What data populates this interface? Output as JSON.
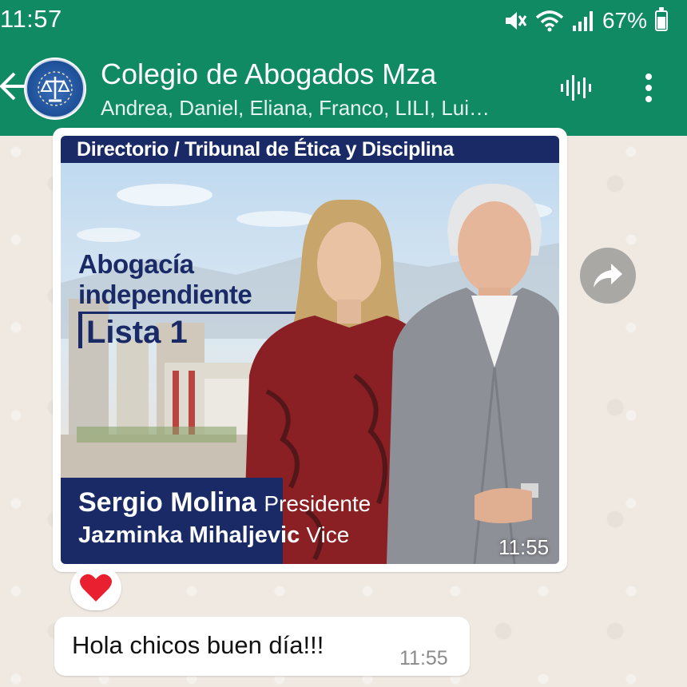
{
  "status_bar": {
    "time": "11:57",
    "battery": "67%",
    "battery_level": 0.67,
    "icons": [
      "mute-icon",
      "wifi-icon",
      "signal-icon",
      "battery-icon"
    ]
  },
  "header": {
    "title": "Colegio de Abogados Mza",
    "subtitle": "Andrea, Daniel, Eliana, Franco, LILI, Lui…",
    "icons": [
      "back-arrow-icon",
      "group-avatar",
      "voice-call-icon",
      "more-options-icon"
    ]
  },
  "messages": {
    "image": {
      "header_text": "Directorio / Tribunal de Ética y Disciplina",
      "slogan_line1": "Abogacía",
      "slogan_line2": "independiente",
      "list": "Lista 1",
      "name1": "Sergio Molina",
      "role1": "Presidente",
      "name2": "Jazminka Mihaljevic",
      "role2": "Vice",
      "time": "11:55"
    },
    "reaction": "heart-icon",
    "text": {
      "body": "Hola chicos buen día!!!",
      "time": "11:55"
    }
  },
  "colors": {
    "header_green": "#0f8a63",
    "poster_navy": "#1a2a66",
    "chat_bg": "#efe9e2",
    "heart_red": "#e8202f"
  }
}
